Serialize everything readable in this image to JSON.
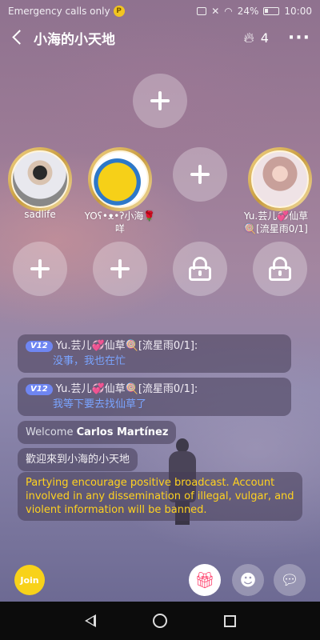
{
  "status_bar": {
    "carrier_text": "Emergency calls only",
    "badge": "P",
    "battery": "24%",
    "time": "10:00"
  },
  "header": {
    "title": "小海的小天地",
    "heat_count": "4"
  },
  "seats": {
    "host_name": "",
    "seat1_name": "sadlife",
    "seat2_name_line1": "YOʕ•ᴥ•ʔ小海🌹",
    "seat2_name_line2": "咩",
    "seat4_name_line1": "Yu.芸儿💞仙草",
    "seat4_name_line2": "🍭[流星雨0/1]"
  },
  "chat": [
    {
      "badge": "V12",
      "user": "Yu.芸儿💞仙草🍭[流星雨0/1]:",
      "text": "没事，我也在忙"
    },
    {
      "badge": "V12",
      "user": "Yu.芸儿💞仙草🍭[流星雨0/1]:",
      "text": "我等下要去找仙草了"
    }
  ],
  "welcome": {
    "prefix": "Welcome",
    "user": "Carlos Martínez"
  },
  "room_greeting": "歡迎來到小海的小天地",
  "notice": "Partying encourage positive broadcast. Account involved in any dissemination of illegal, vulgar, and violent information will be banned.",
  "bottom": {
    "join_label": "Join"
  },
  "colors": {
    "accent_gold": "#f8d21a",
    "vip_badge": "#6f86f2",
    "chat_text": "#7aa4ff",
    "notice_text": "#ffd21f"
  }
}
